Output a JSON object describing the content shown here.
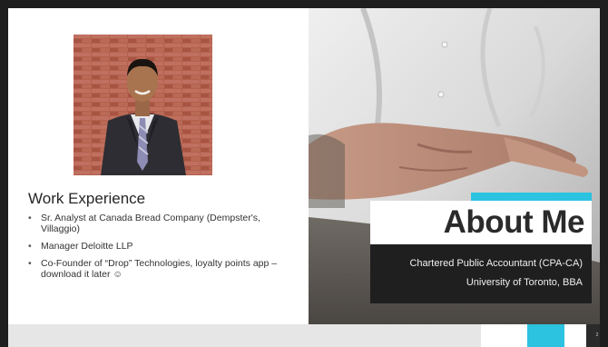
{
  "work_experience": {
    "title": "Work Experience",
    "items": [
      "Sr. Analyst at Canada Bread Company (Dempster's, Villaggio)",
      "Manager Deloitte LLP",
      "Co-Founder of “Drop” Technologies, loyalty points app – download it later ☺"
    ]
  },
  "hero": {
    "title": "About Me",
    "subtitle_line1": "Chartered Public Accountant (CPA-CA)",
    "subtitle_line2": "University of Toronto, BBA"
  },
  "footer": {
    "slide_number": "2"
  },
  "colors": {
    "accent": "#2bc3e0",
    "dark": "#1f1f1f",
    "brick": "#b05a48"
  },
  "icons": {
    "portrait": "person-portrait-photo",
    "hero_photo": "hand-touching-screen-photo"
  }
}
